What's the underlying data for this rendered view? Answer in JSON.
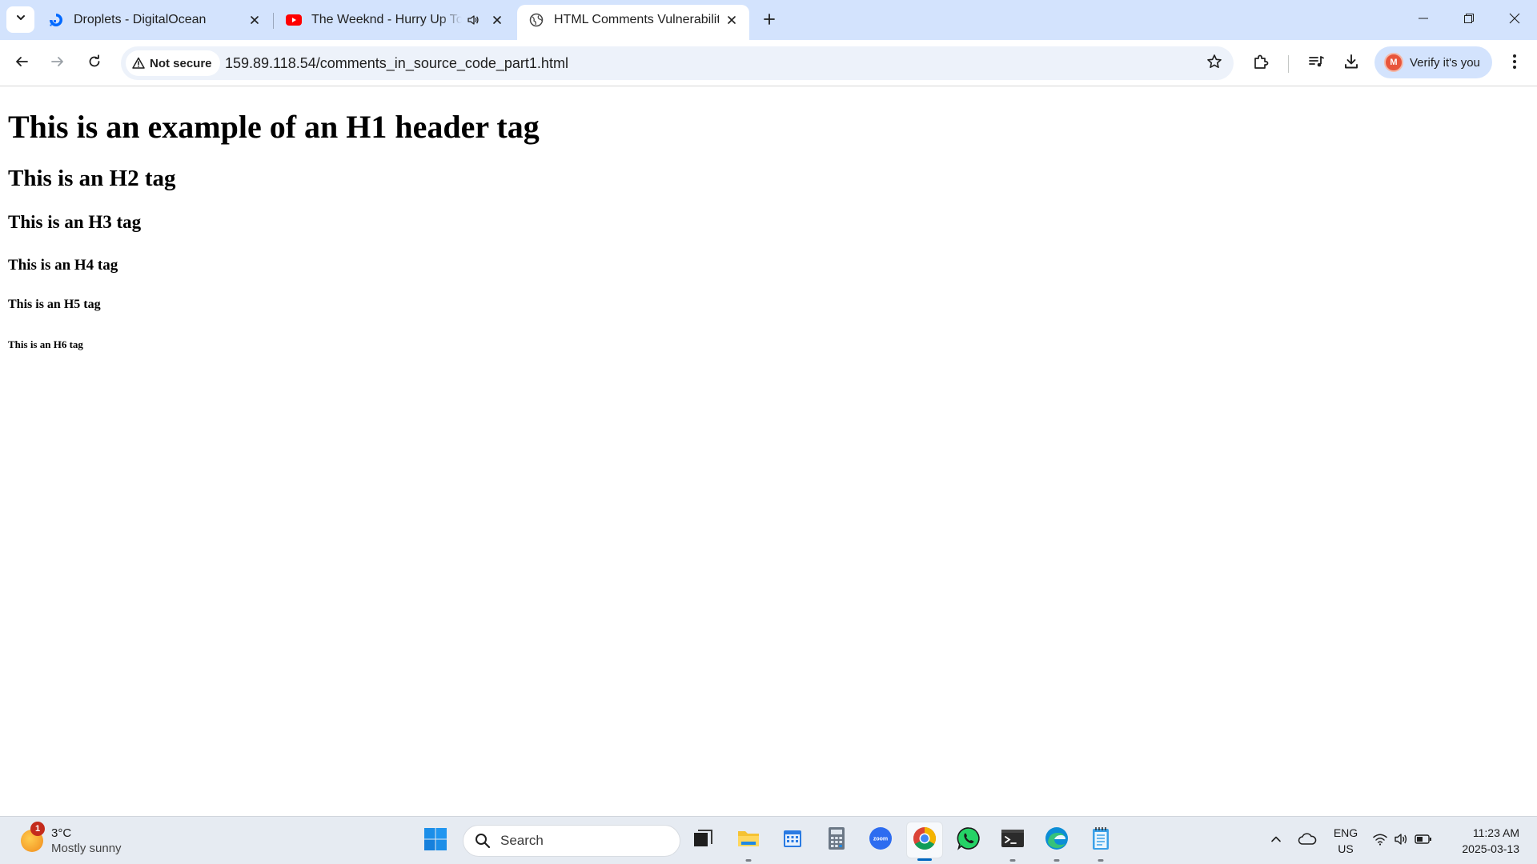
{
  "browser": {
    "tabs": [
      {
        "title": "Droplets - DigitalOcean",
        "favicon": "digitalocean-icon",
        "active": false
      },
      {
        "title": "The Weeknd - Hurry Up Tomorrow",
        "favicon": "youtube-icon",
        "active": false,
        "audio": true
      },
      {
        "title": "HTML Comments Vulnerability",
        "favicon": "globe-icon",
        "active": true
      }
    ],
    "security_label": "Not secure",
    "url": "159.89.118.54/comments_in_source_code_part1.html",
    "profile_label": "Verify it's you",
    "profile_initial": "M"
  },
  "page": {
    "h1": "This is an example of an H1 header tag",
    "h2": "This is an H2 tag",
    "h3": "This is an H3 tag",
    "h4": "This is an H4 tag",
    "h5": "This is an H5 tag",
    "h6": "This is an H6 tag"
  },
  "taskbar": {
    "weather": {
      "temp": "3°C",
      "condition": "Mostly sunny",
      "badge": "1"
    },
    "search_placeholder": "Search",
    "apps": [
      "task-view-icon",
      "file-explorer-icon",
      "calendar-icon",
      "calculator-icon",
      "zoom-icon",
      "chrome-icon",
      "whatsapp-icon",
      "terminal-icon",
      "edge-icon",
      "notepad-icon"
    ],
    "language": {
      "line1": "ENG",
      "line2": "US"
    },
    "clock": {
      "time": "11:23 AM",
      "date": "2025-03-13"
    }
  },
  "colors": {
    "tabstrip": "#d3e3fd",
    "omnibox": "#edf2fa",
    "taskbar": "#e6ebf2",
    "accent": "#0067c0"
  }
}
